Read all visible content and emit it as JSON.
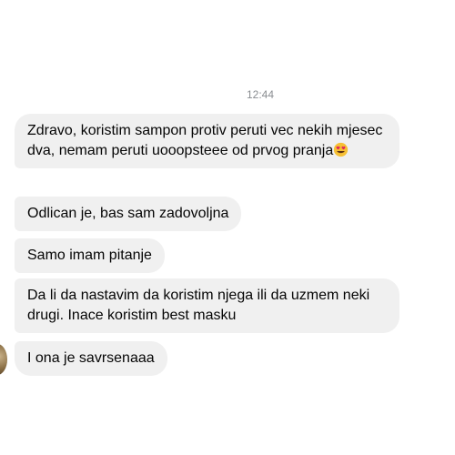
{
  "conversation": {
    "timestamp": "12:44",
    "messages": [
      {
        "text": "Zdravo, koristim sampon protiv peruti vec nekih mjesec dva, nemam peruti uooopsteee od prvog pranja",
        "emoji": "heart-eyes-emoji"
      },
      {
        "text": "Odlican je, bas sam zadovoljna"
      },
      {
        "text": "Samo imam pitanje"
      },
      {
        "text": "Da li da nastavim da koristim njega ili da uzmem neki drugi. Inace koristim best masku"
      },
      {
        "text": "I ona je savrsenaaa"
      }
    ]
  },
  "colors": {
    "bubble_bg": "#f0f0f0",
    "text": "#050505",
    "timestamp": "#8a8d91"
  }
}
